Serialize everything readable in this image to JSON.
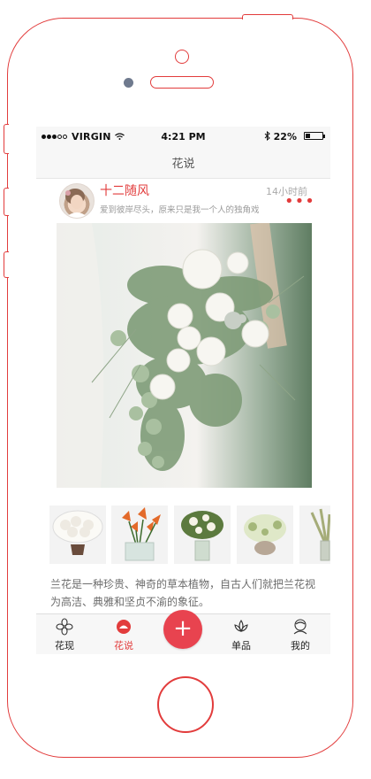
{
  "status_bar": {
    "carrier": "VIRGIN",
    "time": "4:21 PM",
    "battery": "22%"
  },
  "nav": {
    "title": "花说"
  },
  "post": {
    "username": "十二随风",
    "time_ago": "14小时前",
    "signature": "爱到彼岸尽头，原来只是我一个人的独角戏",
    "more_icon": "more-dots-icon",
    "description": "兰花是一种珍贵、神奇的草本植物，自古人们就把兰花视为高洁、典雅和坚贞不渝的象征。"
  },
  "thumbnails": [
    "white-roses-bowl",
    "orange-lilies-vase",
    "white-green-arrangement",
    "white-hydrangea-bowl",
    "wheat-grass-vase"
  ],
  "tabs": [
    {
      "label": "花现",
      "icon": "flower-icon"
    },
    {
      "label": "花说",
      "icon": "chat-bubble-icon"
    },
    {
      "label": "单品",
      "icon": "lotus-icon"
    },
    {
      "label": "我的",
      "icon": "user-icon"
    }
  ],
  "add_button": {
    "label": "+"
  },
  "colors": {
    "accent": "#e23c3c",
    "plus": "#e8434f",
    "text_gray": "#6c6c6c"
  }
}
